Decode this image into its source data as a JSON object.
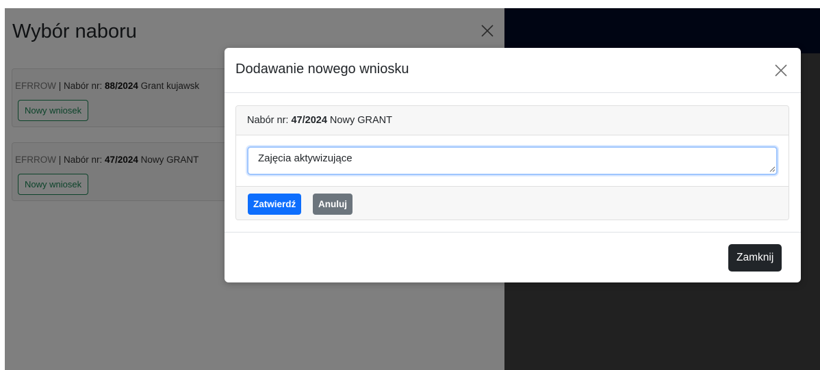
{
  "background_panel": {
    "title": "Wybór naboru",
    "cards": [
      {
        "program": "EFRROW",
        "separator": " | ",
        "nabor_prefix": "Nabór nr: ",
        "nabor_number": "88/2024",
        "nabor_name": " Grant kujawsk",
        "button_label": "Nowy wniosek"
      },
      {
        "program": "EFRROW",
        "separator": " | ",
        "nabor_prefix": "Nabór nr: ",
        "nabor_number": "47/2024",
        "nabor_name": " Nowy GRANT",
        "button_label": "Nowy wniosek"
      }
    ]
  },
  "modal": {
    "title": "Dodawanie nowego wniosku",
    "card_header": {
      "prefix": "Nabór nr: ",
      "number": "47/2024",
      "name": " Nowy GRANT"
    },
    "textarea_value": "Zajęcia aktywizujące",
    "confirm_label": "Zatwierdź",
    "cancel_label": "Anuluj",
    "close_label": "Zamknij"
  },
  "colors": {
    "primary": "#0d6efd",
    "secondary": "#6c757d",
    "dark": "#212529",
    "success": "#198754",
    "navbar": "#000b27"
  },
  "icons": {
    "background_close": "close-icon",
    "modal_close": "close-icon"
  }
}
